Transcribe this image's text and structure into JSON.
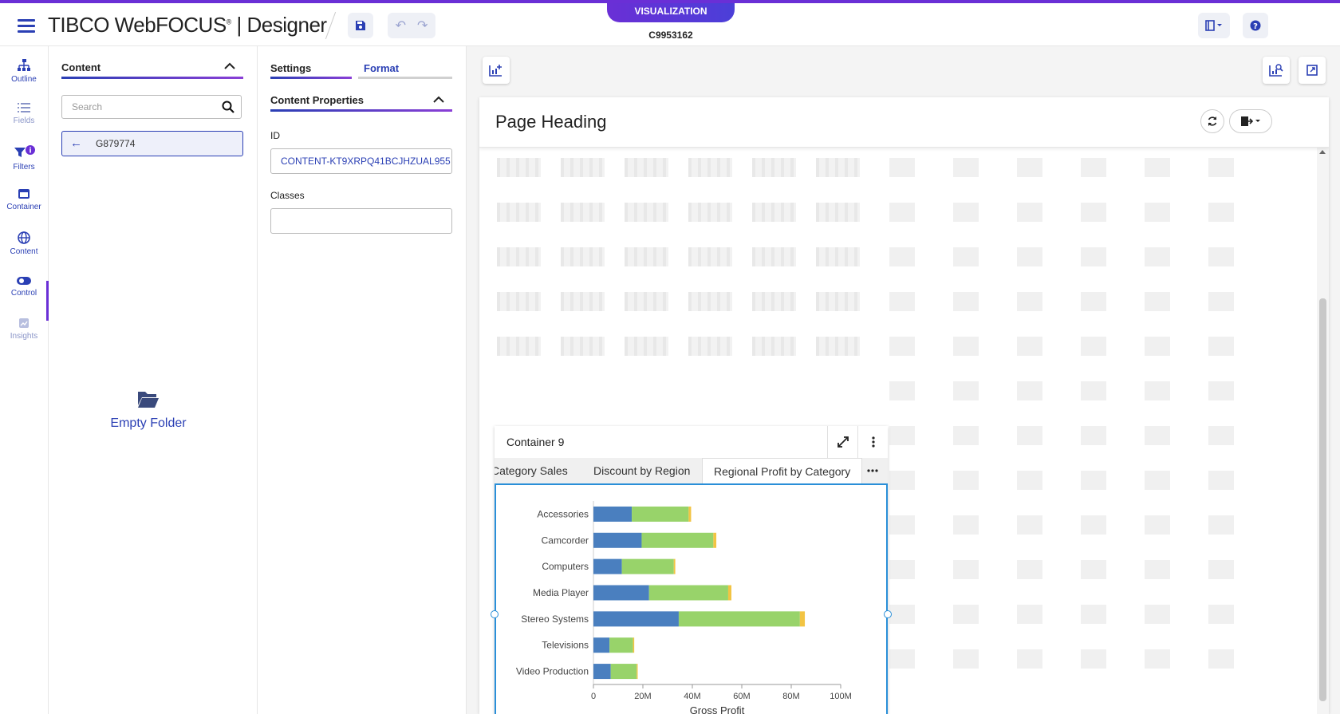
{
  "header": {
    "brand": "TIBCO WebFOCUS",
    "product": "| Designer",
    "mode_label": "VISUALIZATION",
    "viz_id": "C9953162"
  },
  "icon_nav": [
    {
      "label": "Outline",
      "icon": "outline-icon",
      "active": false
    },
    {
      "label": "Fields",
      "icon": "fields-icon",
      "active": false,
      "disabled": true
    },
    {
      "label": "Filters",
      "icon": "filter-icon",
      "active": false
    },
    {
      "label": "Container",
      "icon": "container-icon",
      "active": false
    },
    {
      "label": "Content",
      "icon": "globe-icon",
      "active": true
    },
    {
      "label": "Control",
      "icon": "toggle-icon",
      "active": false
    },
    {
      "label": "Insights",
      "icon": "insights-icon",
      "active": false,
      "disabled": true
    }
  ],
  "content_panel": {
    "title": "Content",
    "search_placeholder": "Search",
    "folder_item": "G879774",
    "empty_label": "Empty Folder"
  },
  "properties_panel": {
    "tabs": [
      {
        "label": "Settings",
        "active": true
      },
      {
        "label": "Format",
        "active": false
      }
    ],
    "section_title": "Content Properties",
    "id_label": "ID",
    "id_value": "CONTENT-KT9XRPQ41BCJHZUAL955",
    "classes_label": "Classes",
    "classes_value": ""
  },
  "page": {
    "heading": "Page Heading"
  },
  "container": {
    "title": "Container 9",
    "tabs": [
      "Category Sales",
      "Discount by Region",
      "Regional Profit by Category"
    ],
    "active_tab": 2
  },
  "colors": {
    "accent": "#2a3fb4",
    "purple": "#6a2fd6",
    "series": [
      "#4a7fbf",
      "#98d36a",
      "#f2c443"
    ]
  },
  "chart_data": {
    "type": "bar",
    "orientation": "horizontal",
    "stacked": true,
    "categories": [
      "Accessories",
      "Camcorder",
      "Computers",
      "Media Player",
      "Stereo Systems",
      "Televisions",
      "Video Production"
    ],
    "series": [
      {
        "values": [
          15.5,
          19.5,
          11.5,
          22.5,
          34.5,
          6.5,
          7
        ]
      },
      {
        "values": [
          23,
          29,
          21,
          32,
          49,
          9.5,
          10.5
        ]
      },
      {
        "values": [
          1,
          1.2,
          0.6,
          1.3,
          2,
          0.5,
          0.4
        ]
      }
    ],
    "xlabel": "Gross Profit",
    "ylabel": "",
    "xlim": [
      0,
      100
    ],
    "x_ticks": [
      "0",
      "20M",
      "40M",
      "60M",
      "80M",
      "100M"
    ],
    "grid": false
  }
}
